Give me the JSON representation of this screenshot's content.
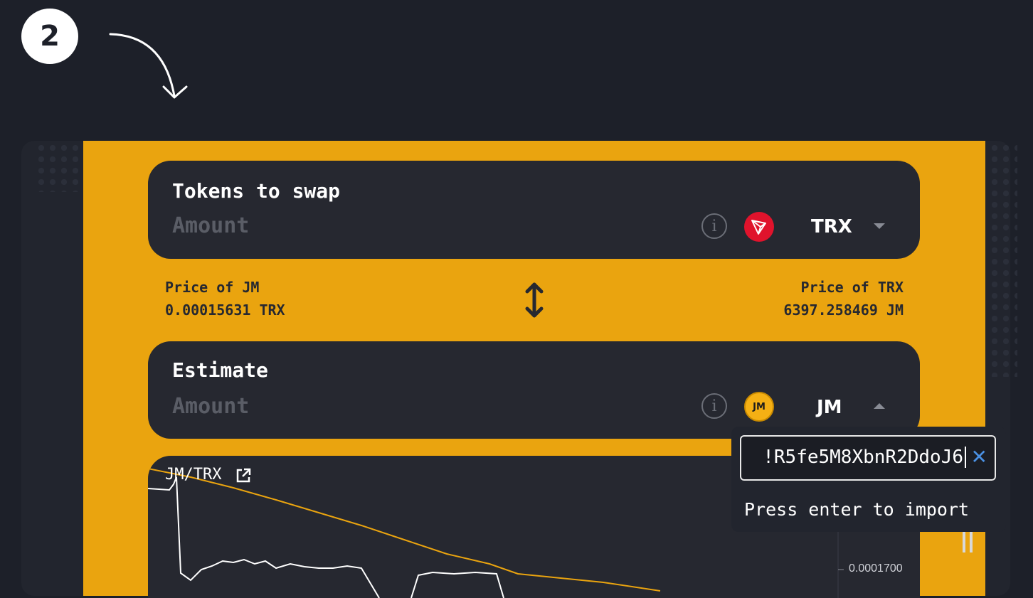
{
  "step": {
    "number": "2"
  },
  "swap_card": {
    "title": "Tokens to swap",
    "amount_placeholder": "Amount",
    "token": "TRX"
  },
  "prices": {
    "left_label": "Price of JM",
    "left_value": "0.00015631 TRX",
    "right_label": "Price of TRX",
    "right_value": "6397.258469 JM"
  },
  "estimate_card": {
    "title": "Estimate",
    "amount_placeholder": "Amount",
    "token": "JM"
  },
  "chart": {
    "pair_label": "JM/TRX",
    "y_tick": "0.0001700"
  },
  "import_popup": {
    "address_visible": "!R5fe5M8XbnR2DdoJ6",
    "hint": "Press enter to import"
  },
  "colors": {
    "background": "#1d2029",
    "accent": "#eaa40f",
    "card": "#262830",
    "tron_red": "#e0132c",
    "jm_gold": "#f5b014",
    "chart_line_price": "#ffffff",
    "chart_line_trend": "#eaa40f",
    "clear_icon": "#4a90e2"
  },
  "icons": [
    "curved-arrow-icon",
    "info-icon",
    "tron-logo-icon",
    "chevron-down-icon",
    "swap-arrows-icon",
    "jm-logo-icon",
    "chevron-up-icon",
    "external-link-icon",
    "clear-icon",
    "pause-icon"
  ]
}
